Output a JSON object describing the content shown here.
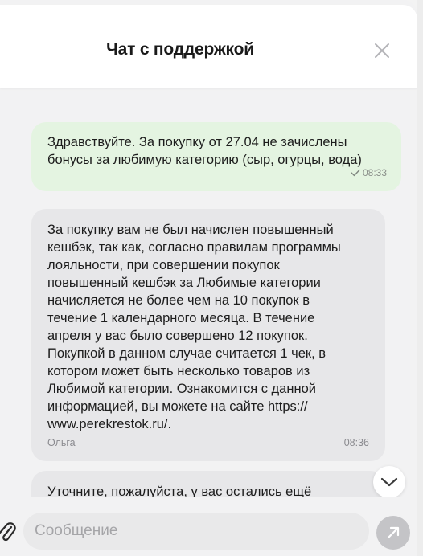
{
  "header": {
    "title": "Чат с поддержкой"
  },
  "messages": [
    {
      "direction": "outgoing",
      "text": "Здравствуйте. За покупку от 27.04 не зачислены бонусы за любимую категорию (сыр, огурцы, вода)",
      "time": "08:33",
      "status": "sent"
    },
    {
      "direction": "incoming",
      "text": "За покупку вам не был начислен повышенный\nкешбэк, так как, согласно правилам программы\nлояльности, при совершении покупок\nповышенный кешбэк за Любимые категории\nначисляется не более чем на 10 покупок в\nтечение 1 календарного месяца. В течение\nапреля у вас было совершено 12 покупок.\nПокупкой в данном случае считается 1 чек, в\nкотором может быть несколько товаров из\nЛюбимой категории. Ознакомится с данной\nинформацией, вы можете на сайте https://\nwww.perekrestok.ru/.",
      "author": "Ольга",
      "time": "08:36"
    },
    {
      "direction": "incoming",
      "text": "Уточните, пожалуйста, у вас остались ещё"
    }
  ],
  "composer": {
    "placeholder": "Сообщение"
  },
  "colors": {
    "outgoing_bubble": "#e4f4e1",
    "incoming_bubble": "#e7e7e9",
    "send_button": "#c4c4c7"
  },
  "icons": {
    "close": "close-icon",
    "check": "check-icon",
    "scroll_down": "chevron-down-icon",
    "attach": "paperclip-icon",
    "send": "arrow-up-right-icon"
  }
}
